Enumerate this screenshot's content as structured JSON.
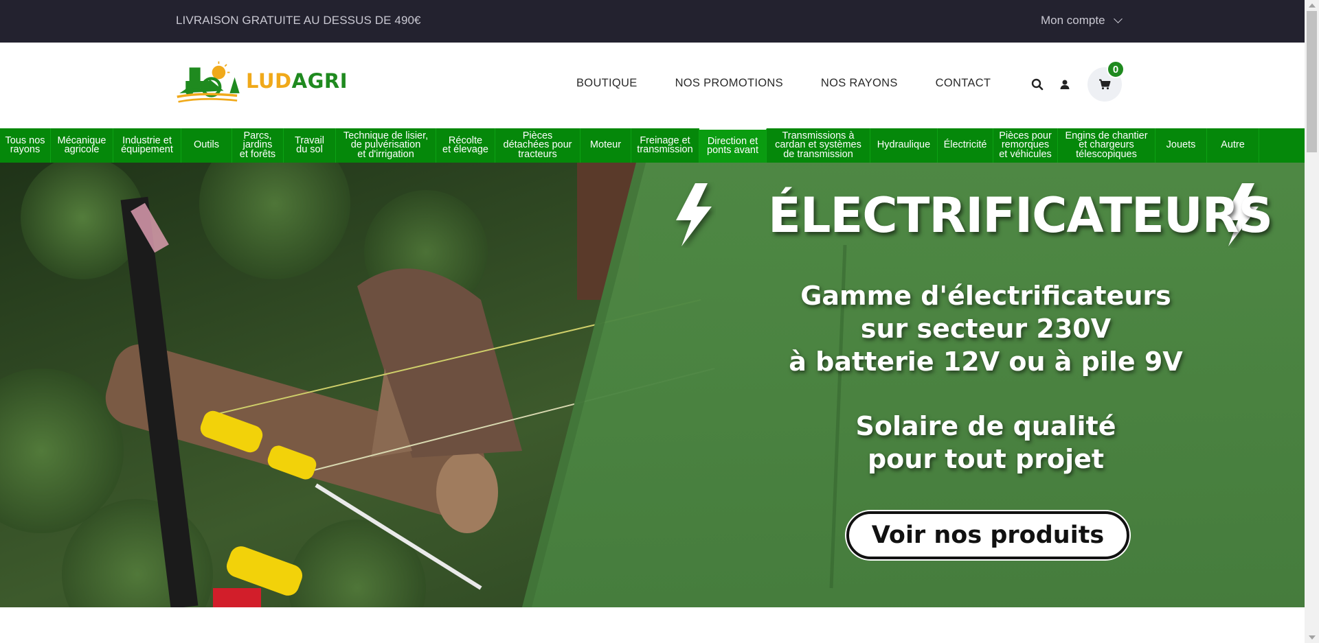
{
  "topbar": {
    "promo": "LIVRAISON GRATUITE AU DESSUS DE 490€",
    "account": "Mon compte"
  },
  "logo": {
    "part1": "LUD",
    "part2": "AGRI"
  },
  "nav": {
    "items": [
      "BOUTIQUE",
      "NOS PROMOTIONS",
      "NOS RAYONS",
      "CONTACT"
    ]
  },
  "icons": {
    "search": "search-icon",
    "user": "user-icon",
    "cart": "cart-icon"
  },
  "cart": {
    "count": "0"
  },
  "categories": [
    {
      "label": "Tous nos\nrayons"
    },
    {
      "label": "Mécanique\nagricole"
    },
    {
      "label": "Industrie et\néquipement"
    },
    {
      "label": "Outils"
    },
    {
      "label": "Parcs,\njardins\net forêts"
    },
    {
      "label": "Travail\ndu sol"
    },
    {
      "label": "Technique de lisier,\nde pulvérisation\net d'irrigation"
    },
    {
      "label": "Récolte\net élevage"
    },
    {
      "label": "Pièces\ndétachées pour\ntracteurs"
    },
    {
      "label": "Moteur"
    },
    {
      "label": "Freinage et\ntransmission"
    },
    {
      "label": "Direction et\nponts avant"
    },
    {
      "label": "Transmissions à\ncardan et systèmes\nde transmission"
    },
    {
      "label": "Hydraulique"
    },
    {
      "label": "Électricité"
    },
    {
      "label": "Pièces pour\nremorques\net véhicules"
    },
    {
      "label": "Engins de chantier\net chargeurs\ntélescopiques"
    },
    {
      "label": "Jouets"
    },
    {
      "label": "Autre"
    }
  ],
  "hero": {
    "title": "ÉLECTRIFICATEURS",
    "line1": "Gamme d'électrificateurs",
    "line2": "sur secteur 230V",
    "line3": "à batterie 12V ou à pile 9V",
    "line4": "Solaire de qualité",
    "line5": "pour tout projet",
    "cta": "Voir nos produits"
  },
  "colors": {
    "topbar": "#23222f",
    "brand_green": "#05880a",
    "brand_yellow": "#f0a91a",
    "hero_green": "#4f8a45"
  }
}
